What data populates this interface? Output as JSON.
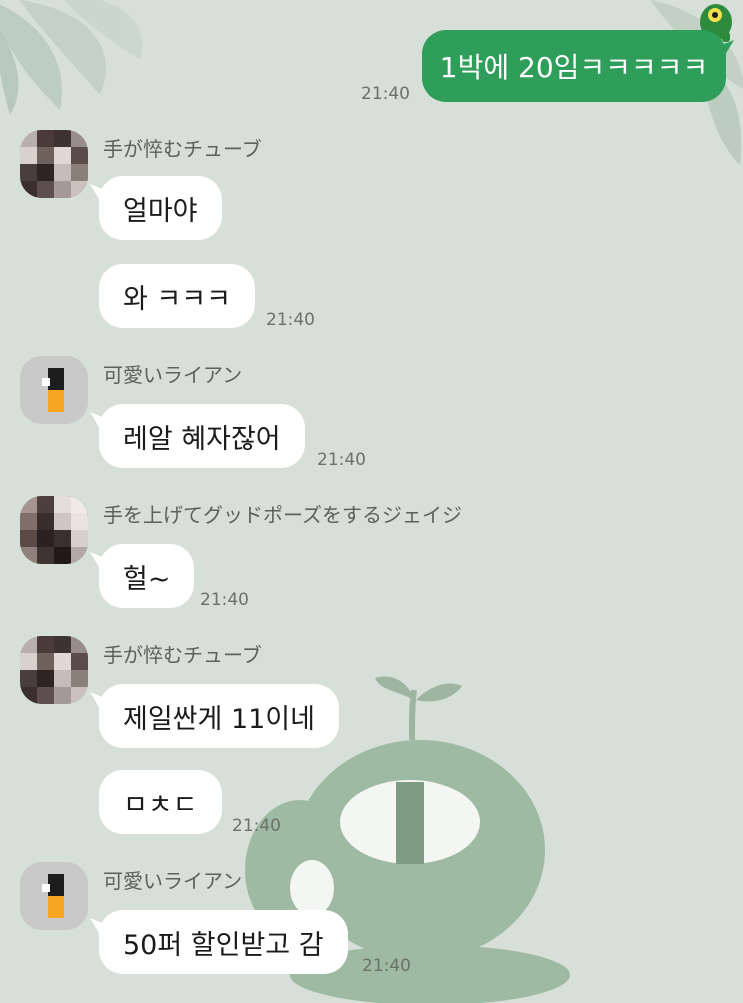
{
  "theme": {
    "background": "#d7e0d8",
    "my_bubble": "#2f9e5a",
    "other_bubble": "#ffffff"
  },
  "chat": {
    "m1": {
      "text": "1박에 20임ㅋㅋㅋㅋㅋ",
      "time": "21:40"
    },
    "g1": {
      "sender": "手が悴むチューブ",
      "m1": "얼마야",
      "m2": "와 ㅋㅋㅋ",
      "time": "21:40"
    },
    "g2": {
      "sender": "可愛いライアン",
      "m1": "레알 혜자잖어",
      "time": "21:40"
    },
    "g3": {
      "sender": "手を上げてグッドポーズをするジェイジ",
      "m1": "헐~",
      "time": "21:40"
    },
    "g4": {
      "sender": "手が悴むチューブ",
      "m1": "제일싼게 11이네",
      "m2": "ㅁㅊㄷ",
      "time": "21:40"
    },
    "g5": {
      "sender": "可愛いライアン",
      "m1": "50퍼 할인받고 감",
      "time": "21:40"
    }
  },
  "icons": {
    "wallpaper_leaves": "leaf-icon",
    "wallpaper_character": "sprout-character-icon",
    "corner_character": "frog-character-icon"
  }
}
